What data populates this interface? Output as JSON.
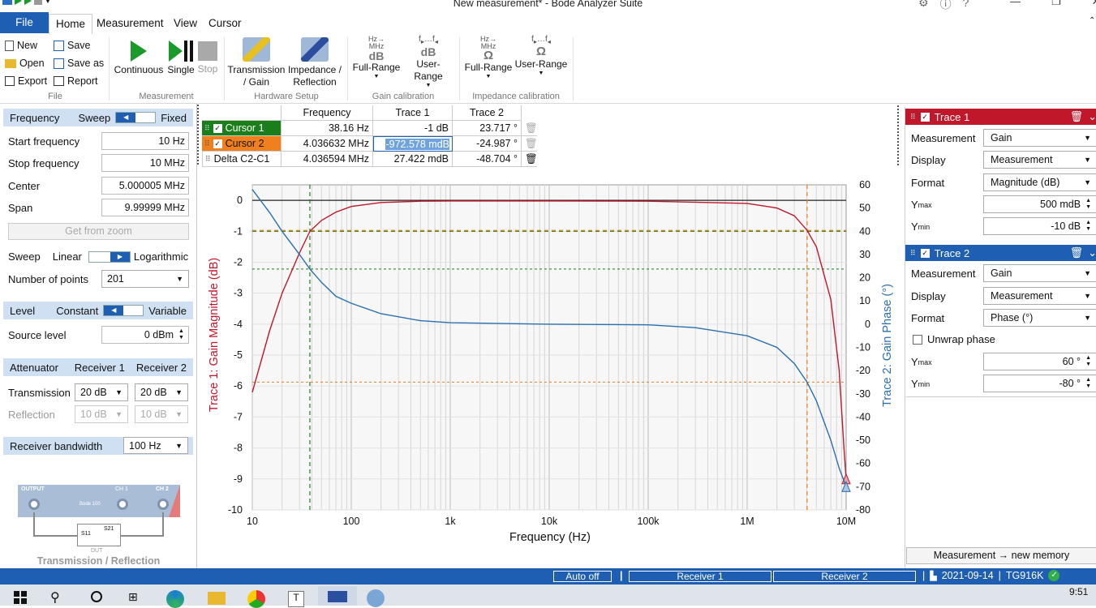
{
  "window": {
    "title": "New measurement* - Bode Analyzer Suite"
  },
  "ribbon_tabs": [
    "File",
    "Home",
    "Measurement",
    "View",
    "Cursor"
  ],
  "file_group": {
    "new": "New",
    "save": "Save",
    "open": "Open",
    "save_as": "Save as",
    "export": "Export",
    "report": "Report",
    "label": "File"
  },
  "measurement_group": {
    "continuous": "Continuous",
    "single": "Single",
    "stop": "Stop",
    "label": "Measurement"
  },
  "hardware_group": {
    "transmission": "Transmission\n/ Gain",
    "impedance": "Impedance /\nReflection",
    "label": "Hardware Setup"
  },
  "gain_cal_group": {
    "full_range": "Full-Range",
    "user_range": "User-Range",
    "label": "Gain calibration"
  },
  "impedance_cal_group": {
    "full_range": "Full-Range",
    "user_range": "User-Range",
    "label": "Impedance calibration"
  },
  "left_panel": {
    "frequency": {
      "label": "Frequency",
      "sweep": "Sweep",
      "fixed": "Fixed"
    },
    "start_frequency": {
      "label": "Start frequency",
      "value": "10 Hz"
    },
    "stop_frequency": {
      "label": "Stop frequency",
      "value": "10 MHz"
    },
    "center": {
      "label": "Center",
      "value": "5.000005 MHz"
    },
    "span": {
      "label": "Span",
      "value": "9.99999 MHz"
    },
    "get_from_zoom": "Get from zoom",
    "sweep": {
      "label": "Sweep",
      "linear": "Linear",
      "logarithmic": "Logarithmic"
    },
    "num_points": {
      "label": "Number of points",
      "value": "201"
    },
    "level": {
      "label": "Level",
      "constant": "Constant",
      "variable": "Variable"
    },
    "source_level": {
      "label": "Source level",
      "value": "0 dBm"
    },
    "attenuator": {
      "label": "Attenuator",
      "r1": "Receiver 1",
      "r2": "Receiver 2"
    },
    "transmission": {
      "label": "Transmission",
      "r1": "20 dB",
      "r2": "20 dB"
    },
    "reflection": {
      "label": "Reflection",
      "r1": "10 dB",
      "r2": "10 dB"
    },
    "receiver_bandwidth": {
      "label": "Receiver bandwidth",
      "value": "100 Hz"
    },
    "diagram": {
      "output": "OUTPUT",
      "ch1": "CH 1",
      "ch2": "CH 2",
      "device": "Bode 100",
      "s11": "S11",
      "s21": "S21",
      "dut": "DUT",
      "caption": "Transmission / Reflection"
    }
  },
  "cursor_table": {
    "headers": [
      "Frequency",
      "Trace 1",
      "Trace 2"
    ],
    "rows": [
      {
        "name": "Cursor 1",
        "freq": "38.16 Hz",
        "t1": "-1 dB",
        "t2": "23.717 °",
        "color": "#1a7f1a"
      },
      {
        "name": "Cursor 2",
        "freq": "4.036632 MHz",
        "t1": "-972.578 mdB",
        "t2": "-24.987 °",
        "color": "#f0801e"
      },
      {
        "name": "Delta C2-C1",
        "freq": "4.036594 MHz",
        "t1": "27.422 mdB",
        "t2": "-48.704 °",
        "color": ""
      }
    ]
  },
  "chart_data": {
    "type": "line",
    "xlabel": "Frequency (Hz)",
    "ylabel_left": "Trace 1: Gain Magnitude (dB)",
    "ylabel_right": "Trace 2: Gain Phase (°)",
    "x_scale": "log",
    "xlim": [
      10,
      10000000
    ],
    "x_ticks": [
      "10",
      "100",
      "1k",
      "10k",
      "100k",
      "1M",
      "10M"
    ],
    "ylim_left": [
      -10,
      0.5
    ],
    "y_ticks_left": [
      "0",
      "-1",
      "-2",
      "-3",
      "-4",
      "-5",
      "-6",
      "-7",
      "-8",
      "-9",
      "-10"
    ],
    "ylim_right": [
      -80,
      60
    ],
    "y_ticks_right": [
      "60",
      "50",
      "40",
      "30",
      "20",
      "10",
      "0",
      "-10",
      "-20",
      "-30",
      "-40",
      "-50",
      "-60",
      "-70",
      "-80"
    ],
    "grid": true,
    "series": [
      {
        "name": "Trace 1",
        "axis": "left",
        "color": "#c0172b",
        "x": [
          10,
          15,
          20,
          30,
          38.16,
          50,
          70,
          100,
          200,
          500,
          1000,
          10000,
          100000,
          1000000,
          2000000,
          3000000,
          4036632,
          5000000,
          7000000,
          8500000,
          9500000,
          10000000
        ],
        "y": [
          -6.2,
          -4.2,
          -3.0,
          -1.7,
          -1.0,
          -0.65,
          -0.38,
          -0.2,
          -0.07,
          -0.03,
          -0.02,
          -0.02,
          -0.03,
          -0.1,
          -0.25,
          -0.5,
          -0.97,
          -1.5,
          -3.2,
          -5.5,
          -8.0,
          -9.0
        ]
      },
      {
        "name": "Trace 2",
        "axis": "right",
        "color": "#2a6fb0",
        "x": [
          10,
          15,
          20,
          30,
          38.16,
          50,
          70,
          100,
          200,
          500,
          1000,
          10000,
          100000,
          300000,
          1000000,
          2000000,
          3000000,
          4036632,
          5000000,
          7000000,
          8500000,
          10000000
        ],
        "y": [
          58,
          48,
          40,
          30,
          23.7,
          18,
          12,
          9,
          4.5,
          1.5,
          0.6,
          0,
          -0.3,
          -1.5,
          -5,
          -10,
          -17,
          -25,
          -33,
          -50,
          -62,
          -70
        ]
      }
    ],
    "cursors": [
      {
        "name": "Cursor 1",
        "x": 38.16,
        "y_left": -1,
        "y_right": 23.717,
        "color": "#1a7f1a"
      },
      {
        "name": "Cursor 2",
        "x": 4036632,
        "y_left": -0.972578,
        "y_right": -24.987,
        "color": "#f0801e"
      }
    ]
  },
  "right_panel": {
    "trace1": {
      "title": "Trace 1",
      "measurement_label": "Measurement",
      "measurement": "Gain",
      "display_label": "Display",
      "display": "Measurement",
      "format_label": "Format",
      "format": "Magnitude (dB)",
      "ymax_label": "Y",
      "ymax_sub": "max",
      "ymax": "500 mdB",
      "ymin_label": "Y",
      "ymin_sub": "min",
      "ymin": "-10 dB",
      "color": "#c0172b"
    },
    "trace2": {
      "title": "Trace 2",
      "measurement_label": "Measurement",
      "measurement": "Gain",
      "display_label": "Display",
      "display": "Measurement",
      "format_label": "Format",
      "format": "Phase (°)",
      "unwrap": "Unwrap phase",
      "ymax_label": "Y",
      "ymax_sub": "max",
      "ymax": "60 °",
      "ymin_label": "Y",
      "ymin_sub": "min",
      "ymin": "-80 °",
      "color": "#1e5fb4"
    },
    "memory_button": "Measurement → new memory"
  },
  "status_bar": {
    "auto_off": "Auto off",
    "receiver1": "Receiver 1",
    "receiver2": "Receiver 2",
    "date": "2021-09-14",
    "device": "TG916K"
  },
  "taskbar": {
    "time": "9:51"
  }
}
